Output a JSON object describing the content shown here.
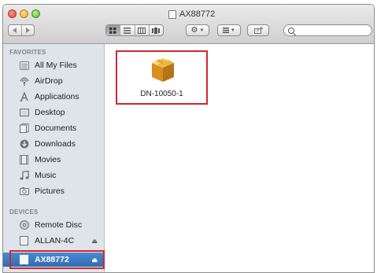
{
  "window": {
    "title": "AX88772"
  },
  "toolbar": {
    "back_icon": "chevron-left-icon",
    "forward_icon": "chevron-right-icon",
    "view_modes": [
      "icon-view",
      "list-view",
      "column-view",
      "coverflow-view"
    ],
    "active_view": "icon-view",
    "action_icon": "gear-icon",
    "arrange_icon": "arrange-icon",
    "share_icon": "share-icon",
    "search_placeholder": ""
  },
  "sidebar": {
    "favorites_header": "FAVORITES",
    "favorites": [
      {
        "label": "All My Files",
        "icon": "all-files-icon"
      },
      {
        "label": "AirDrop",
        "icon": "airdrop-icon"
      },
      {
        "label": "Applications",
        "icon": "applications-icon"
      },
      {
        "label": "Desktop",
        "icon": "desktop-icon"
      },
      {
        "label": "Documents",
        "icon": "documents-icon"
      },
      {
        "label": "Downloads",
        "icon": "downloads-icon"
      },
      {
        "label": "Movies",
        "icon": "movies-icon"
      },
      {
        "label": "Music",
        "icon": "music-icon"
      },
      {
        "label": "Pictures",
        "icon": "pictures-icon"
      }
    ],
    "devices_header": "DEVICES",
    "devices": [
      {
        "label": "Remote Disc",
        "icon": "remote-disc-icon",
        "eject": false
      },
      {
        "label": "ALLAN-4C",
        "icon": "drive-icon",
        "eject": true
      },
      {
        "label": "AX88772",
        "icon": "drive-icon",
        "eject": true,
        "selected": true
      }
    ]
  },
  "content": {
    "files": [
      {
        "name": "DN-10050-1",
        "icon": "package-icon"
      }
    ]
  },
  "colors": {
    "highlight": "#d3262e",
    "selection": "#3a78c2",
    "sidebar_bg": "#dfe4ea"
  }
}
